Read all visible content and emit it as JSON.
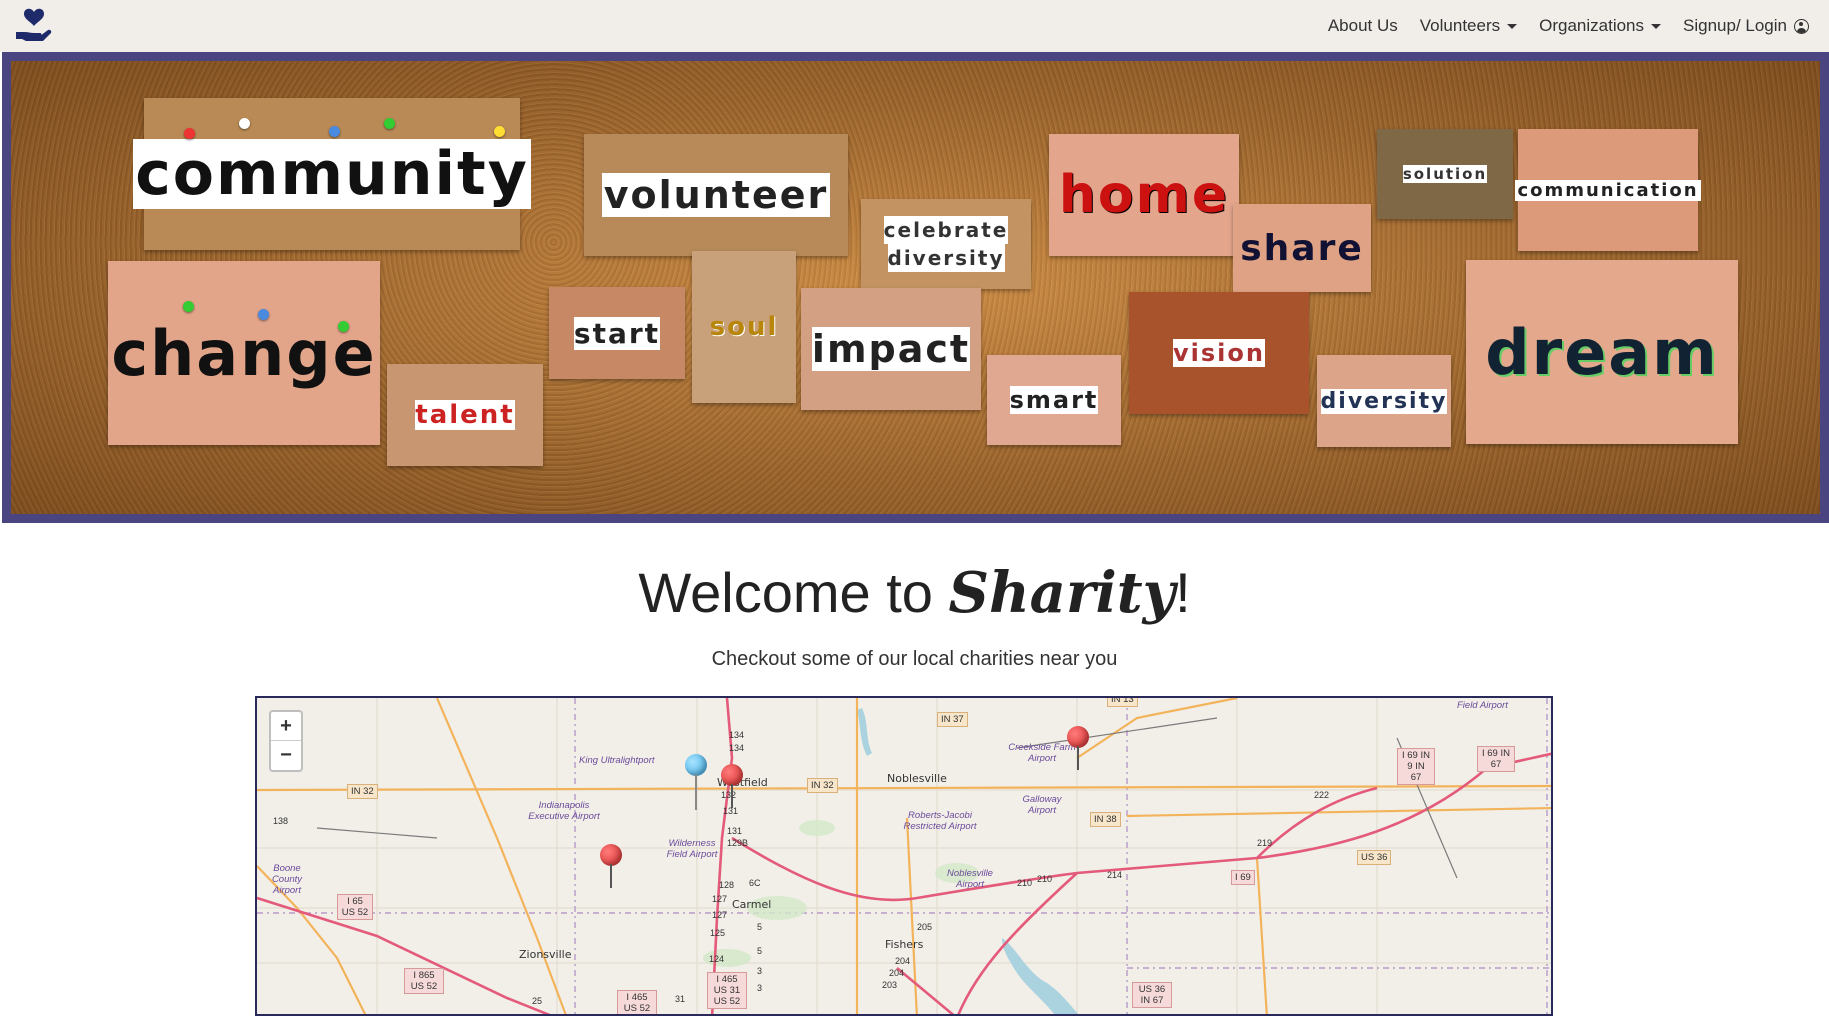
{
  "nav": {
    "brand_icon": "hand-heart-icon",
    "about": "About Us",
    "volunteers": "Volunteers",
    "organizations": "Organizations",
    "signup": "Signup/ Login"
  },
  "banner": {
    "words": [
      "community",
      "volunteer",
      "celebrate",
      "diversity",
      "home",
      "share",
      "solution",
      "communication",
      "change",
      "start",
      "soul",
      "impact",
      "talent",
      "smart",
      "vision",
      "diversity",
      "dream"
    ]
  },
  "welcome": {
    "prefix": "Welcome to ",
    "brand": "Sharity",
    "suffix": "!",
    "subtitle": "Checkout some of our local charities near you"
  },
  "map": {
    "zoom_in": "+",
    "zoom_out": "−",
    "towns": [
      "Westfield",
      "Noblesville",
      "Carmel",
      "Fishers",
      "Zionsville"
    ],
    "airports": [
      "King Ultralightport",
      "Indianapolis Executive Airport",
      "Boone County Airport",
      "Wilderness Field Airport",
      "Roberts-Jacobi Restricted Airport",
      "Noblesville Airport",
      "Creekside Farm Airport",
      "Galloway Airport",
      "Field Airport"
    ],
    "roads": [
      "IN 37",
      "IN 32",
      "IN 32",
      "IN 38",
      "I 69 IN 9 IN 67",
      "I 69 IN 67",
      "US 36",
      "I 69",
      "I 65 US 52",
      "I 865 US 52",
      "I 465 US 31 US 52",
      "I 465 US 52",
      "US 36 IN 67",
      "IN 13"
    ],
    "exits": [
      "134",
      "134",
      "132",
      "131",
      "131",
      "129B",
      "128",
      "6C",
      "127",
      "127",
      "125",
      "124",
      "5",
      "5",
      "3",
      "3",
      "205",
      "204",
      "204",
      "203",
      "210",
      "210",
      "214",
      "219",
      "222",
      "138",
      "31",
      "25"
    ],
    "colors": {
      "marker_red": "#d42a2a",
      "marker_blue": "#3aa7e0",
      "frame": "#4a4580"
    }
  }
}
